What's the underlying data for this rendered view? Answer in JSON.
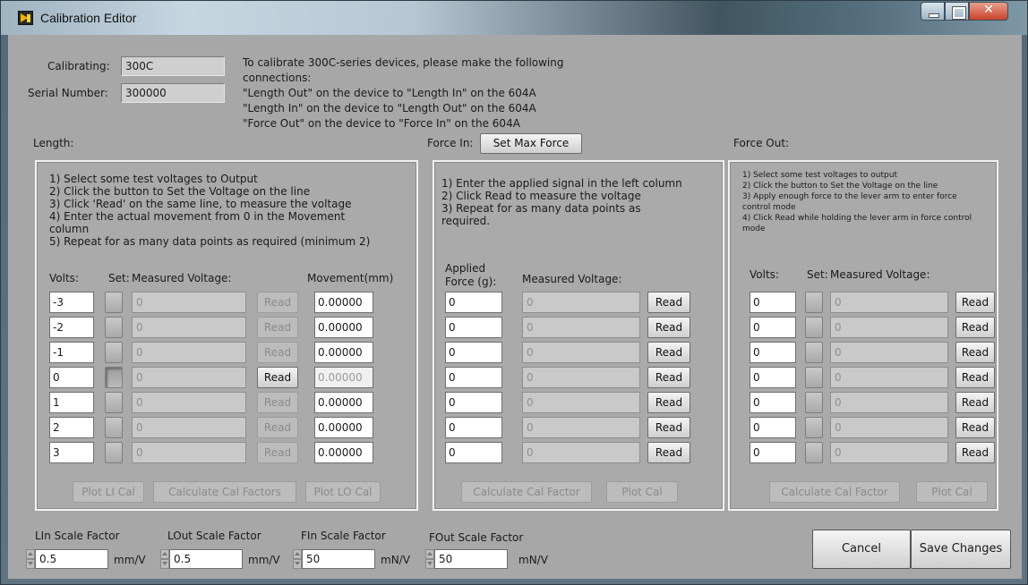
{
  "window": {
    "title": "Calibration Editor"
  },
  "header": {
    "calibrating_label": "Calibrating:",
    "calibrating_value": "300C",
    "serial_label": "Serial Number:",
    "serial_value": "300000",
    "instructions": [
      "To calibrate 300C-series devices, please make the following",
      "connections:",
      "\"Length Out\" on the device to \"Length In\" on the 604A",
      "\"Length In\" on the device to \"Length Out\" on the 604A",
      "\"Force Out\" on the device to \"Force In\" on the 604A"
    ]
  },
  "length": {
    "title": "Length:",
    "instructions": "1) Select some test voltages to Output\n2) Click the button to Set the Voltage on the line\n3) Click 'Read' on the same line, to measure the voltage\n4) Enter the actual movement from 0 in the Movement\ncolumn\n5) Repeat for as many data points as required (minimum 2)",
    "col_volts": "Volts:",
    "col_set": "Set:",
    "col_measured": "Measured Voltage:",
    "col_movement": "Movement(mm)",
    "rows": [
      {
        "volts": "-3",
        "measured": "0",
        "read": "Read",
        "movement": "0.00000"
      },
      {
        "volts": "-2",
        "measured": "0",
        "read": "Read",
        "movement": "0.00000"
      },
      {
        "volts": "-1",
        "measured": "0",
        "read": "Read",
        "movement": "0.00000"
      },
      {
        "volts": "0",
        "measured": "0",
        "read": "Read",
        "movement": "0.00000"
      },
      {
        "volts": "1",
        "measured": "0",
        "read": "Read",
        "movement": "0.00000"
      },
      {
        "volts": "2",
        "measured": "0",
        "read": "Read",
        "movement": "0.00000"
      },
      {
        "volts": "3",
        "measured": "0",
        "read": "Read",
        "movement": "0.00000"
      }
    ],
    "btn_plot_li": "Plot LI Cal",
    "btn_calc": "Calculate Cal Factors",
    "btn_plot_lo": "Plot LO Cal"
  },
  "force_in": {
    "title": "Force In:",
    "btn_set_max": "Set Max Force",
    "instructions": "1) Enter the applied signal in the left column\n2) Click Read to measure the voltage\n3) Repeat for as many data points as\nrequired.",
    "col_applied": "Applied\nForce (g):",
    "col_measured": "Measured Voltage:",
    "rows": [
      {
        "applied": "0",
        "measured": "0",
        "read": "Read"
      },
      {
        "applied": "0",
        "measured": "0",
        "read": "Read"
      },
      {
        "applied": "0",
        "measured": "0",
        "read": "Read"
      },
      {
        "applied": "0",
        "measured": "0",
        "read": "Read"
      },
      {
        "applied": "0",
        "measured": "0",
        "read": "Read"
      },
      {
        "applied": "0",
        "measured": "0",
        "read": "Read"
      },
      {
        "applied": "0",
        "measured": "0",
        "read": "Read"
      }
    ],
    "btn_calc": "Calculate Cal Factor",
    "btn_plot": "Plot Cal"
  },
  "force_out": {
    "title": "Force Out:",
    "instructions": "1) Select some test voltages to output\n2) Click the button to Set the Voltage on the line\n3) Apply enough force to the lever arm to enter force\ncontrol mode\n4) Click Read while holding the lever arm in force control\nmode",
    "col_volts": "Volts:",
    "col_set": "Set:",
    "col_measured": "Measured Voltage:",
    "rows": [
      {
        "volts": "0",
        "measured": "0",
        "read": "Read"
      },
      {
        "volts": "0",
        "measured": "0",
        "read": "Read"
      },
      {
        "volts": "0",
        "measured": "0",
        "read": "Read"
      },
      {
        "volts": "0",
        "measured": "0",
        "read": "Read"
      },
      {
        "volts": "0",
        "measured": "0",
        "read": "Read"
      },
      {
        "volts": "0",
        "measured": "0",
        "read": "Read"
      },
      {
        "volts": "0",
        "measured": "0",
        "read": "Read"
      }
    ],
    "btn_calc": "Calculate Cal Factor",
    "btn_plot": "Plot Cal"
  },
  "scale_factors": {
    "lin": {
      "label": "LIn Scale Factor",
      "value": "0.5",
      "unit": "mm/V"
    },
    "lout": {
      "label": "LOut Scale Factor",
      "value": "0.5",
      "unit": "mm/V"
    },
    "fin": {
      "label": "FIn Scale Factor",
      "value": "50",
      "unit": "mN/V"
    },
    "fout": {
      "label": "FOut Scale Factor",
      "value": "50",
      "unit": "mN/V"
    }
  },
  "footer": {
    "cancel": "Cancel",
    "save": "Save Changes"
  }
}
